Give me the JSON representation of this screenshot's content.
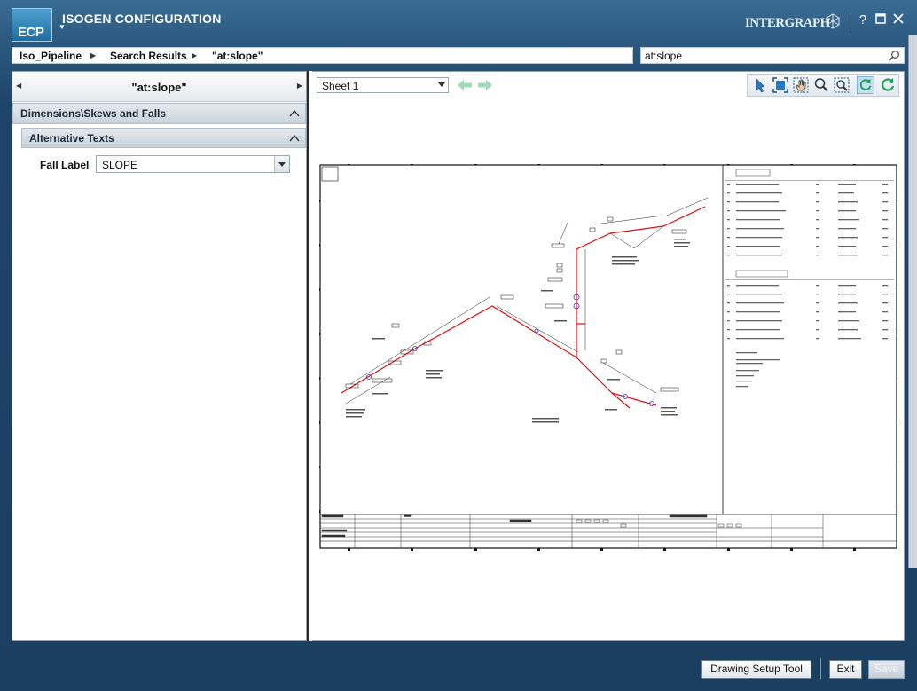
{
  "app": {
    "logo": "ECP",
    "title": "ISOGEN CONFIGURATION",
    "brand": "INTERGRAPH"
  },
  "window_controls": {
    "help": "?"
  },
  "breadcrumb": [
    "Iso_Pipeline",
    "Search Results",
    "\"at:slope\""
  ],
  "search": {
    "value": "at:slope"
  },
  "left_panel": {
    "nav_title": "\"at:slope\"",
    "section": "Dimensions\\Skews and Falls",
    "subsection": "Alternative Texts",
    "field_label": "Fall Label",
    "field_value": "SLOPE"
  },
  "viewer": {
    "sheet": "Sheet 1",
    "tools": [
      "select-pointer-icon",
      "fit-window-icon",
      "pan-hand-icon",
      "zoom-icon",
      "zoom-extents-icon",
      "sync-icon",
      "refresh-icon"
    ],
    "active_tool": "sync-icon"
  },
  "footer": {
    "drawing_setup": "Drawing Setup Tool",
    "exit": "Exit",
    "save": "Save"
  },
  "colors": {
    "pipe": "#e01010",
    "accent": "#2f5c82"
  }
}
